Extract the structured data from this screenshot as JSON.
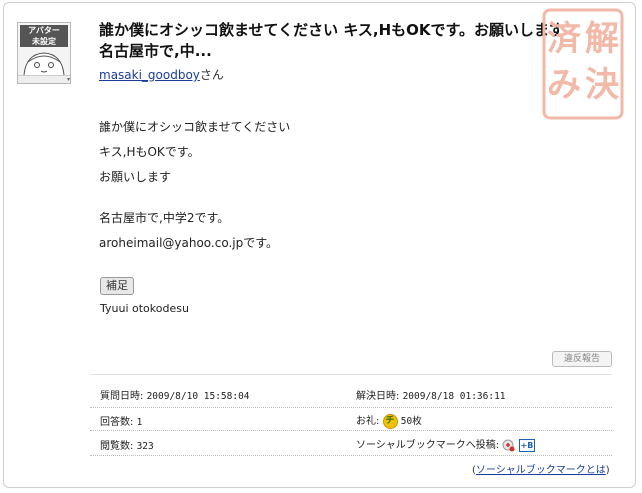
{
  "avatar": {
    "banner_line1": "アバター",
    "banner_line2": "未設定",
    "dropdown_glyph": "▾"
  },
  "question": {
    "title": "誰か僕にオシッコ飲ませてください キス,HもOKです。お願いします 名古屋市で,中...",
    "asker_name": "masaki_goodboy",
    "asker_suffix": "さん",
    "stamp_chars": [
      "解",
      "決",
      "済",
      "み"
    ],
    "stamp_color": "#f2b8a8",
    "body": [
      "誰か僕にオシッコ飲ませてください",
      "キス,HもOKです。",
      "お願いします",
      "名古屋市で,中学2です。",
      "aroheimail@yahoo.co.jpです。"
    ]
  },
  "supplement": {
    "button_label": "補足",
    "text": "Tyuui otokodesu"
  },
  "report_button": "違反報告",
  "info": {
    "asked_label": "質問日時:",
    "asked_value": "2009/8/10 15:58:04",
    "resolved_label": "解決日時:",
    "resolved_value": "2009/8/18 01:36:11",
    "answers_label": "回答数:",
    "answers_value": "1",
    "reward_label": "お礼:",
    "reward_icon": "チ",
    "reward_value": "50枚",
    "views_label": "閲覧数:",
    "views_value": "323",
    "social_label": "ソーシャルブックマークへ投稿:",
    "hatena_label": "B"
  },
  "social_help": {
    "open": "(",
    "link": "ソーシャルブックマークとは",
    "close": ")"
  },
  "colors": {
    "link": "#1a3d9b",
    "stamp": "#f2b8a8",
    "coin": "#f2c200"
  }
}
